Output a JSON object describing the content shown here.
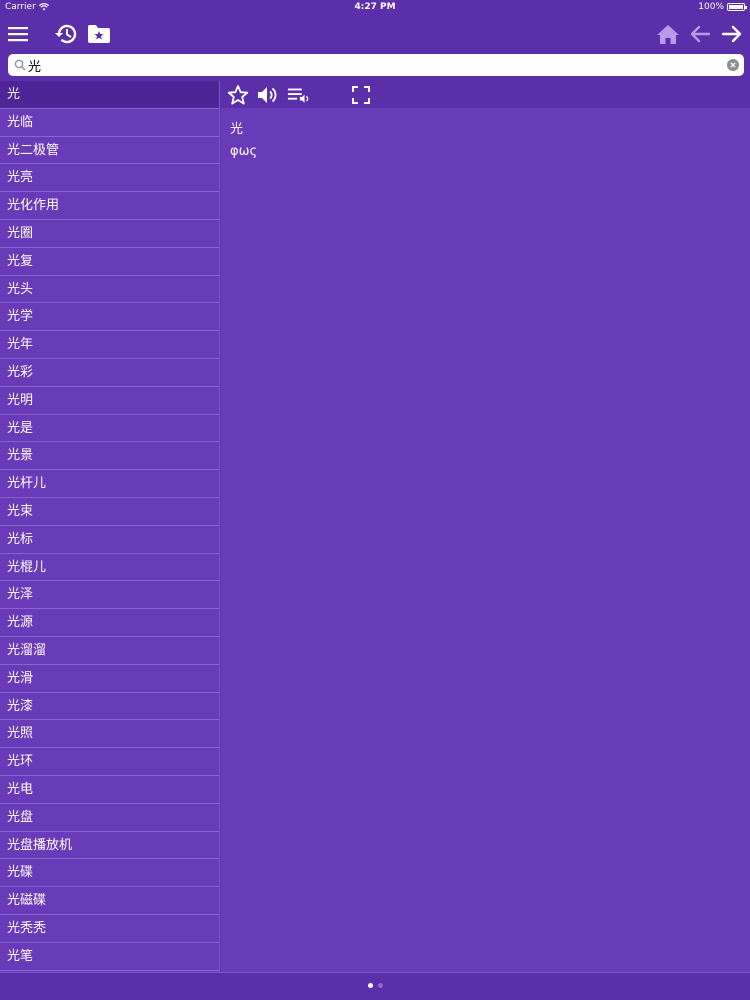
{
  "status_bar": {
    "carrier": "Carrier",
    "time": "4:27 PM",
    "battery": "100%"
  },
  "toolbar": {
    "left_icons": [
      "menu-icon",
      "history-icon",
      "favorites-folder-icon"
    ],
    "right_icons": [
      "home-icon",
      "back-arrow-icon",
      "forward-arrow-icon"
    ]
  },
  "search": {
    "value": "光",
    "placeholder": ""
  },
  "word_list": {
    "selected_index": 0,
    "items": [
      "光",
      "光临",
      "光二极管",
      "光亮",
      "光化作用",
      "光圈",
      "光复",
      "光头",
      "光学",
      "光年",
      "光彩",
      "光明",
      "光是",
      "光景",
      "光杆儿",
      "光束",
      "光标",
      "光棍儿",
      "光泽",
      "光源",
      "光溜溜",
      "光滑",
      "光漆",
      "光照",
      "光环",
      "光电",
      "光盘",
      "光盘播放机",
      "光碟",
      "光磁碟",
      "光秃秃",
      "光笔"
    ]
  },
  "detail": {
    "toolbar_icons": [
      "star-icon",
      "speaker-icon",
      "playlist-speaker-icon",
      "fullscreen-icon"
    ],
    "headword": "光",
    "translation": "φως"
  },
  "pager": {
    "pages": 2,
    "current": 0
  },
  "colors": {
    "background": "#5a2fa9",
    "list_background": "#6a3bb9",
    "selected_row": "#4d2597",
    "divider": "#8a64cf",
    "home_icon": "#b79be6"
  }
}
